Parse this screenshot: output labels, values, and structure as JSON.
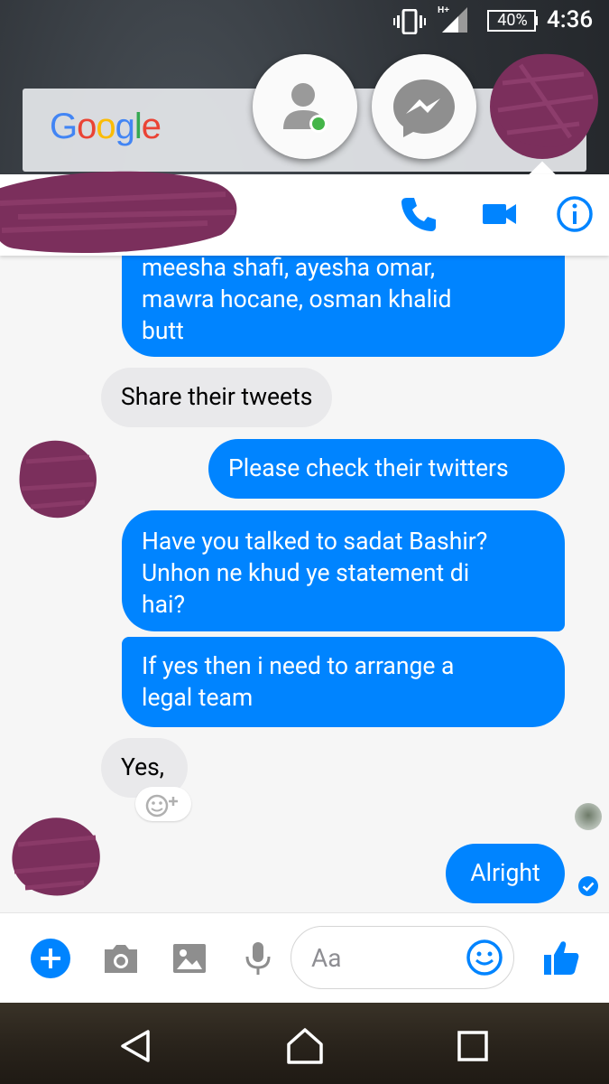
{
  "status_bar": {
    "battery": "40%",
    "time": "4:36",
    "network": "H+"
  },
  "google_widget": {
    "logo_text": "Google"
  },
  "chat_heads": [
    "people-icon",
    "messenger-icon",
    "contact-avatar"
  ],
  "header": {
    "actions": [
      "call-icon",
      "video-icon",
      "info-icon"
    ]
  },
  "messages": [
    {
      "direction": "out",
      "lines": [
        "meesha shafi, ayesha omar,",
        "mawra hocane, osman khalid",
        "butt"
      ]
    },
    {
      "direction": "in",
      "text": "Share their tweets"
    },
    {
      "direction": "out",
      "text": "Please check their twitters"
    },
    {
      "direction": "out",
      "lines": [
        "Have you talked to sadat Bashir?",
        "Unhon ne khud ye statement di",
        "hai?"
      ]
    },
    {
      "direction": "out",
      "lines": [
        "If yes then i need to arrange a",
        "legal team"
      ]
    },
    {
      "direction": "in",
      "text": "Yes,"
    },
    {
      "direction": "out",
      "text": "Alright"
    }
  ],
  "composer": {
    "placeholder": "Aa"
  },
  "colors": {
    "outgoing_bubble": "#0084ff",
    "incoming_bubble": "#e9e9eb",
    "accent": "#0084ff",
    "redaction": "#7b2f5c"
  }
}
